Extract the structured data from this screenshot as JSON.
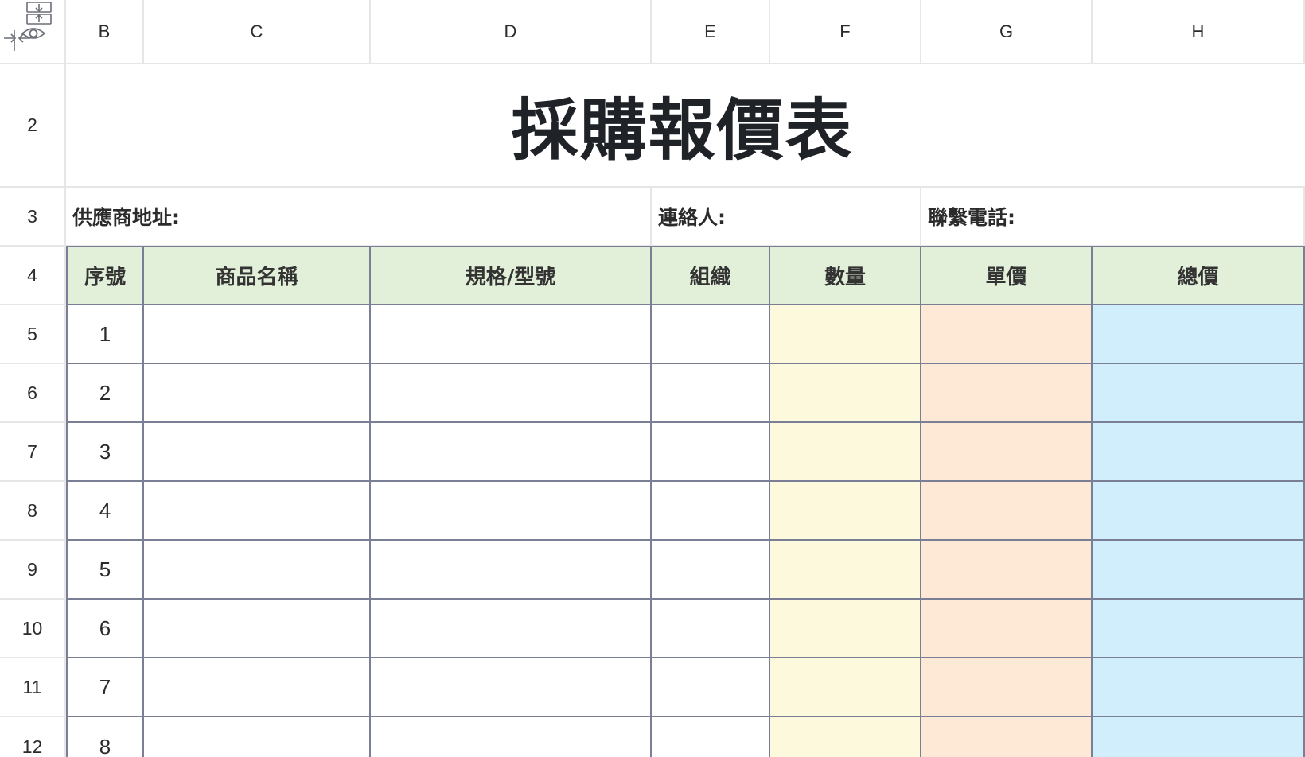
{
  "spreadsheet": {
    "columns": [
      "B",
      "C",
      "D",
      "E",
      "F",
      "G",
      "H"
    ],
    "rows": [
      "2",
      "3",
      "4",
      "5",
      "6",
      "7",
      "8",
      "9",
      "10",
      "11",
      "12"
    ],
    "title": "採購報價表",
    "info": {
      "supplier_address": "供應商地址:",
      "contact": "連絡人:",
      "phone": "聯繫電話:"
    },
    "table_headers": [
      "序號",
      "商品名稱",
      "規格/型號",
      "組織",
      "數量",
      "單價",
      "總價"
    ],
    "sequence_numbers": [
      "1",
      "2",
      "3",
      "4",
      "5",
      "6",
      "7",
      "8"
    ],
    "column_fill_colors": {
      "header": "#e2efd9",
      "quantity": "#fdf9dc",
      "unit_price": "#fde9d5",
      "total_price": "#d0eefb"
    }
  }
}
